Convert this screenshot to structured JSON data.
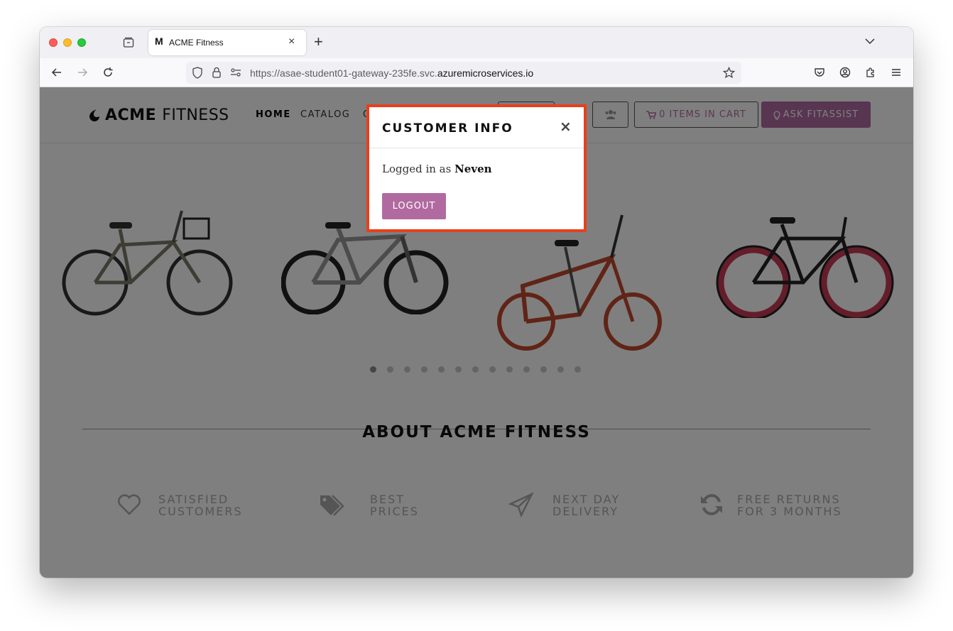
{
  "browser": {
    "tab_favicon": "M",
    "tab_title": "ACME Fitness",
    "tab_close": "×",
    "new_tab": "+",
    "url_prefix": "https://asae-student01-gateway-235fe.svc.",
    "url_domain": "azuremicroservices.io"
  },
  "site": {
    "logo_bold": "ACME",
    "logo_light": "FITNESS",
    "nav": [
      "HOME",
      "CATALOG",
      "C"
    ],
    "cart_label": "0 ITEMS IN CART",
    "ask_label": "ASK FITASSIST",
    "about_title": "ABOUT ACME FITNESS",
    "features": [
      {
        "icon": "heart-icon",
        "line1": "SATISFIED",
        "line2": "CUSTOMERS"
      },
      {
        "icon": "tags-icon",
        "line1": "BEST",
        "line2": "PRICES"
      },
      {
        "icon": "paper-plane-icon",
        "line1": "NEXT DAY",
        "line2": "DELIVERY"
      },
      {
        "icon": "refresh-icon",
        "line1": "FREE RETURNS",
        "line2": "FOR 3 MONTHS"
      }
    ],
    "carousel": {
      "slides": 13,
      "active_index": 0
    }
  },
  "modal": {
    "title": "CUSTOMER INFO",
    "close": "×",
    "logged_in_prefix": "Logged in as",
    "username": "Neven",
    "logout_label": "LOGOUT"
  },
  "colors": {
    "accent": "#b16aa0",
    "highlight_border": "#e8401c"
  }
}
